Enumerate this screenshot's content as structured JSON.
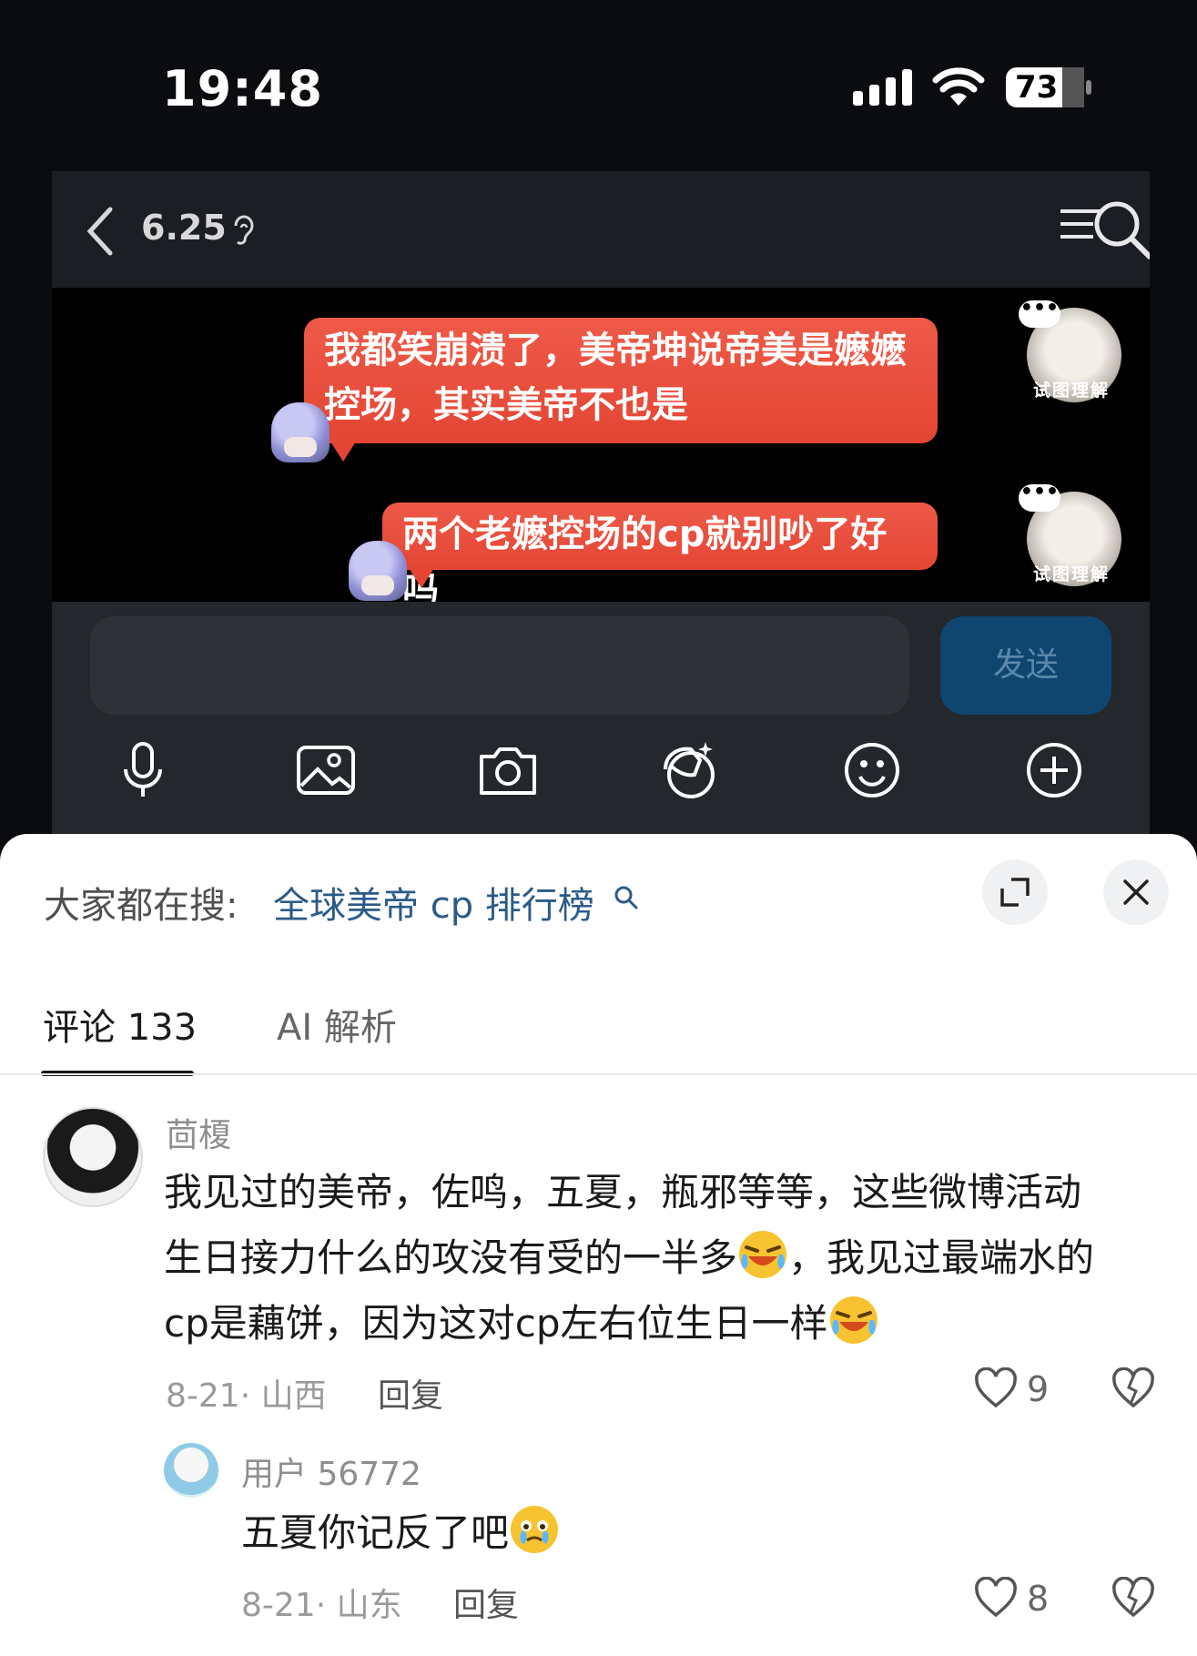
{
  "status_bar": {
    "time": "19:48",
    "battery": "73"
  },
  "chat": {
    "title": "6.25",
    "messages": [
      {
        "text_line1": "我都笑崩溃了，美帝坤说帝美是嬷嬷",
        "text_line2": "控场，其实美帝不也是"
      },
      {
        "text": "两个老嬷控场的cp就别吵了好吗"
      }
    ],
    "avatar_label": "试图理解",
    "avatar_badge": "•••",
    "send_label": "发送"
  },
  "sheet": {
    "search_prefix": "大家都在搜:",
    "search_term": "全球美帝 cp 排行榜",
    "tabs": [
      {
        "label": "评论 133"
      },
      {
        "label": "AI 解析"
      }
    ]
  },
  "comments": [
    {
      "username": "茴榎",
      "line1": "我见过的美帝，佐鸣，五夏，瓶邪等等，这些微博活动",
      "line2": "生日接力什么的攻没有受的一半多",
      "line2_tail": "，我见过最端水的",
      "line3": "cp是藕饼，因为这对cp左右位生日一样",
      "date": "8-21",
      "location": "· 山西",
      "reply_label": "回复",
      "likes": "9"
    },
    {
      "username": "用户 56772",
      "text": "五夏你记反了吧",
      "date": "8-21",
      "location": "· 山东",
      "reply_label": "回复",
      "likes": "8"
    }
  ]
}
